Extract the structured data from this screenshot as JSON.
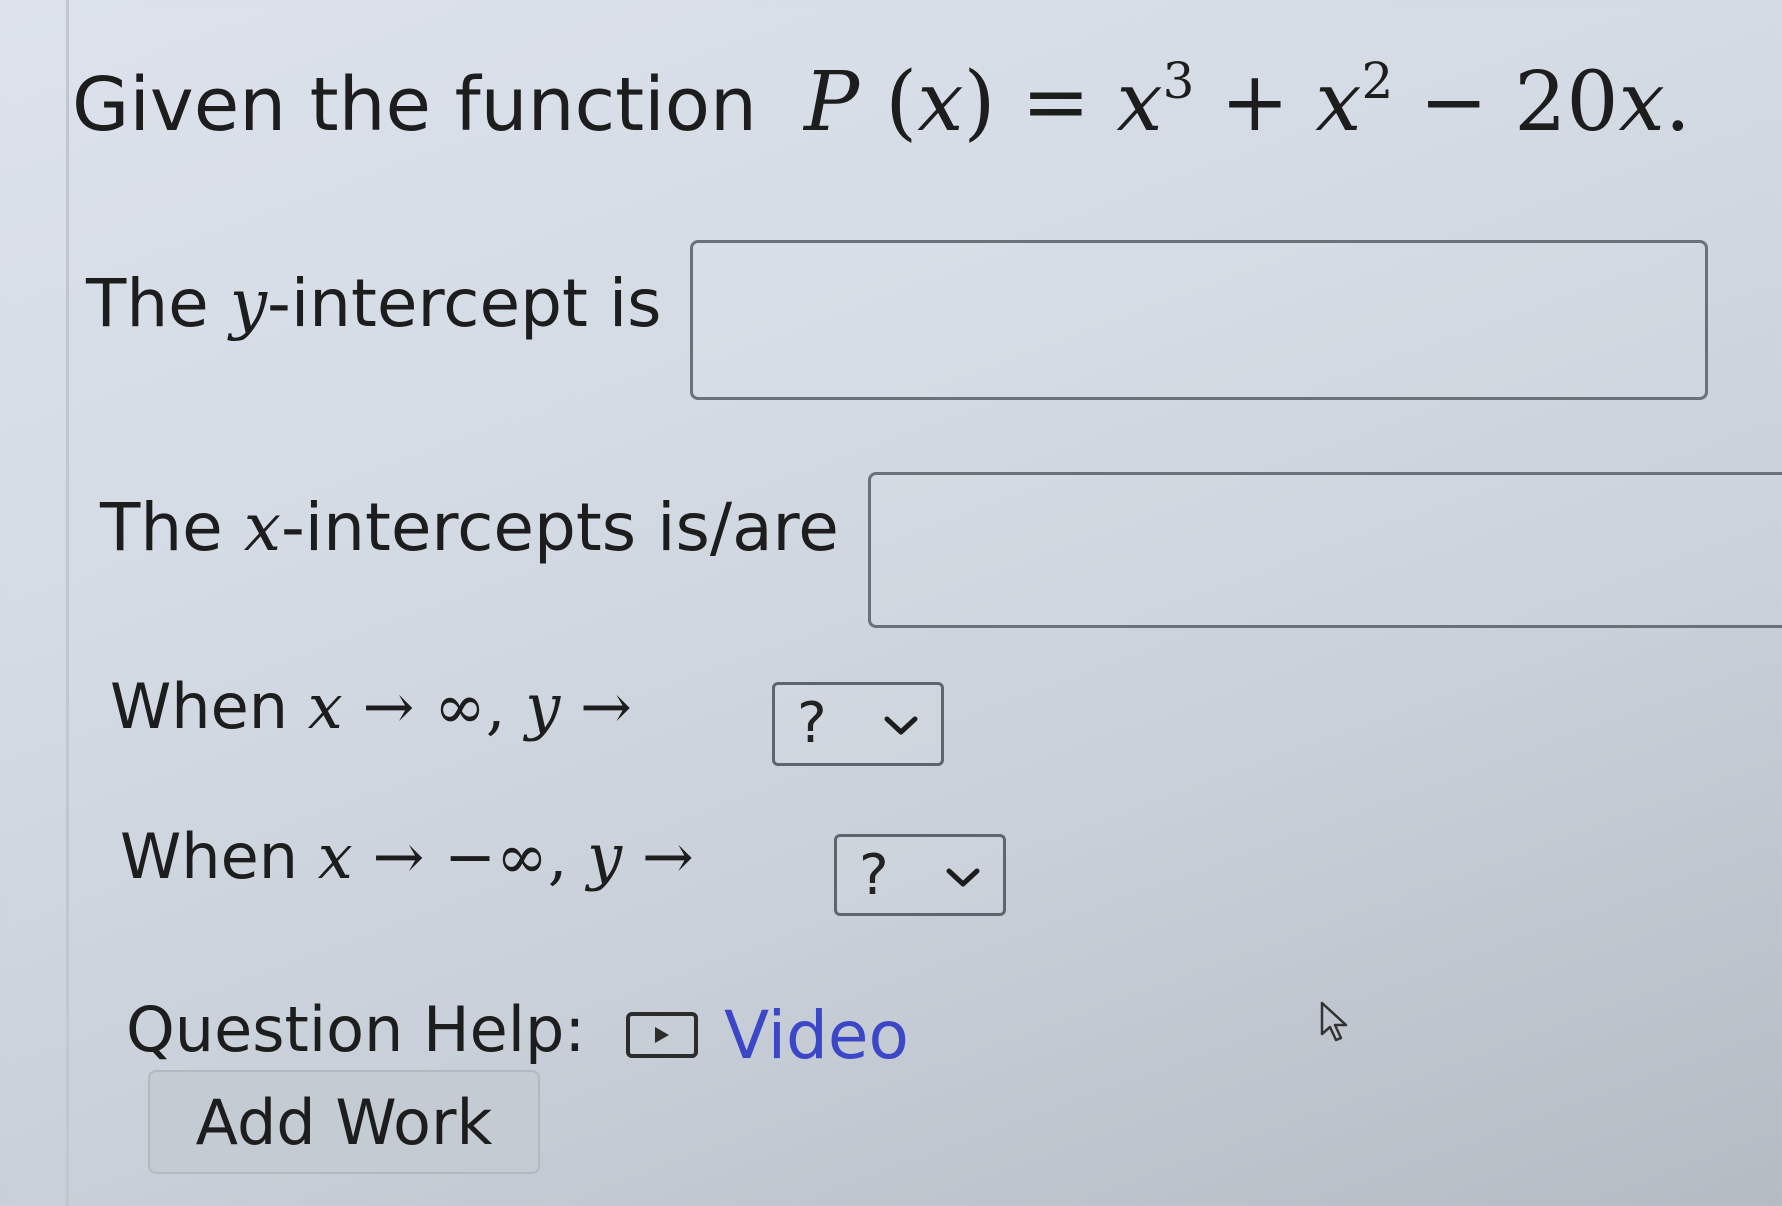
{
  "question": {
    "intro_text": "Given the function",
    "function_name": "P",
    "function_var": "x",
    "equals": "=",
    "term1_base": "x",
    "term1_exp": "3",
    "plus": "+",
    "term2_base": "x",
    "term2_exp": "2",
    "minus": "−",
    "term3_coef": "20",
    "term3_var": "x",
    "period": "."
  },
  "y_intercept": {
    "label_prefix": "The ",
    "label_var": "y",
    "label_suffix": "-intercept is",
    "value": ""
  },
  "x_intercepts": {
    "label_prefix": "The ",
    "label_var": "x",
    "label_suffix": "-intercepts is/are",
    "value": ""
  },
  "limit_pos": {
    "when": "When",
    "x_var": "x",
    "arrow": "→",
    "target": "∞",
    "comma": ",",
    "y_var": "y",
    "selected": "?"
  },
  "limit_neg": {
    "when": "When",
    "x_var": "x",
    "arrow": "→",
    "target": "−∞",
    "comma": ",",
    "y_var": "y",
    "selected": "?"
  },
  "help": {
    "label": "Question Help:",
    "video_label": "Video",
    "video_icon": "play-icon"
  },
  "add_work_label": "Add Work",
  "colors": {
    "link": "#3c47c8",
    "border": "#6b7178"
  }
}
